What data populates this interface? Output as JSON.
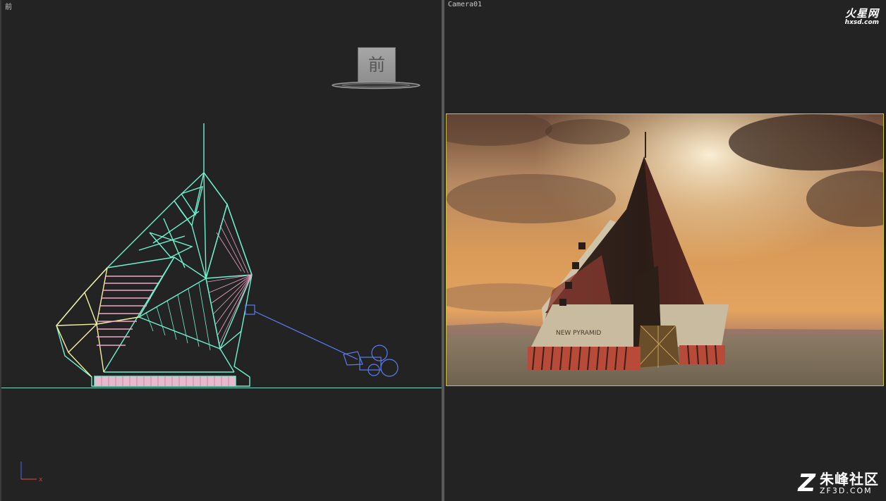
{
  "viewports": {
    "left": {
      "label": "前",
      "viewcube_label": "前"
    },
    "right": {
      "label": "Camera01"
    }
  },
  "render": {
    "sign_text": "NEW PYRAMID"
  },
  "watermarks": {
    "top": {
      "brand": "火星网",
      "url": "hxsd.com"
    },
    "bottom": {
      "logo": "Z",
      "name": "朱峰社区",
      "site": "ZF3D.COM"
    }
  },
  "gizmo": {
    "x_label": "x"
  },
  "colors": {
    "wire_cyan": "#6ff2cf",
    "wire_pink": "#f0a8c8",
    "wire_yellow": "#f5f0a0",
    "camera_blue": "#5a7cf0",
    "frame_yellow": "#c9c240"
  }
}
